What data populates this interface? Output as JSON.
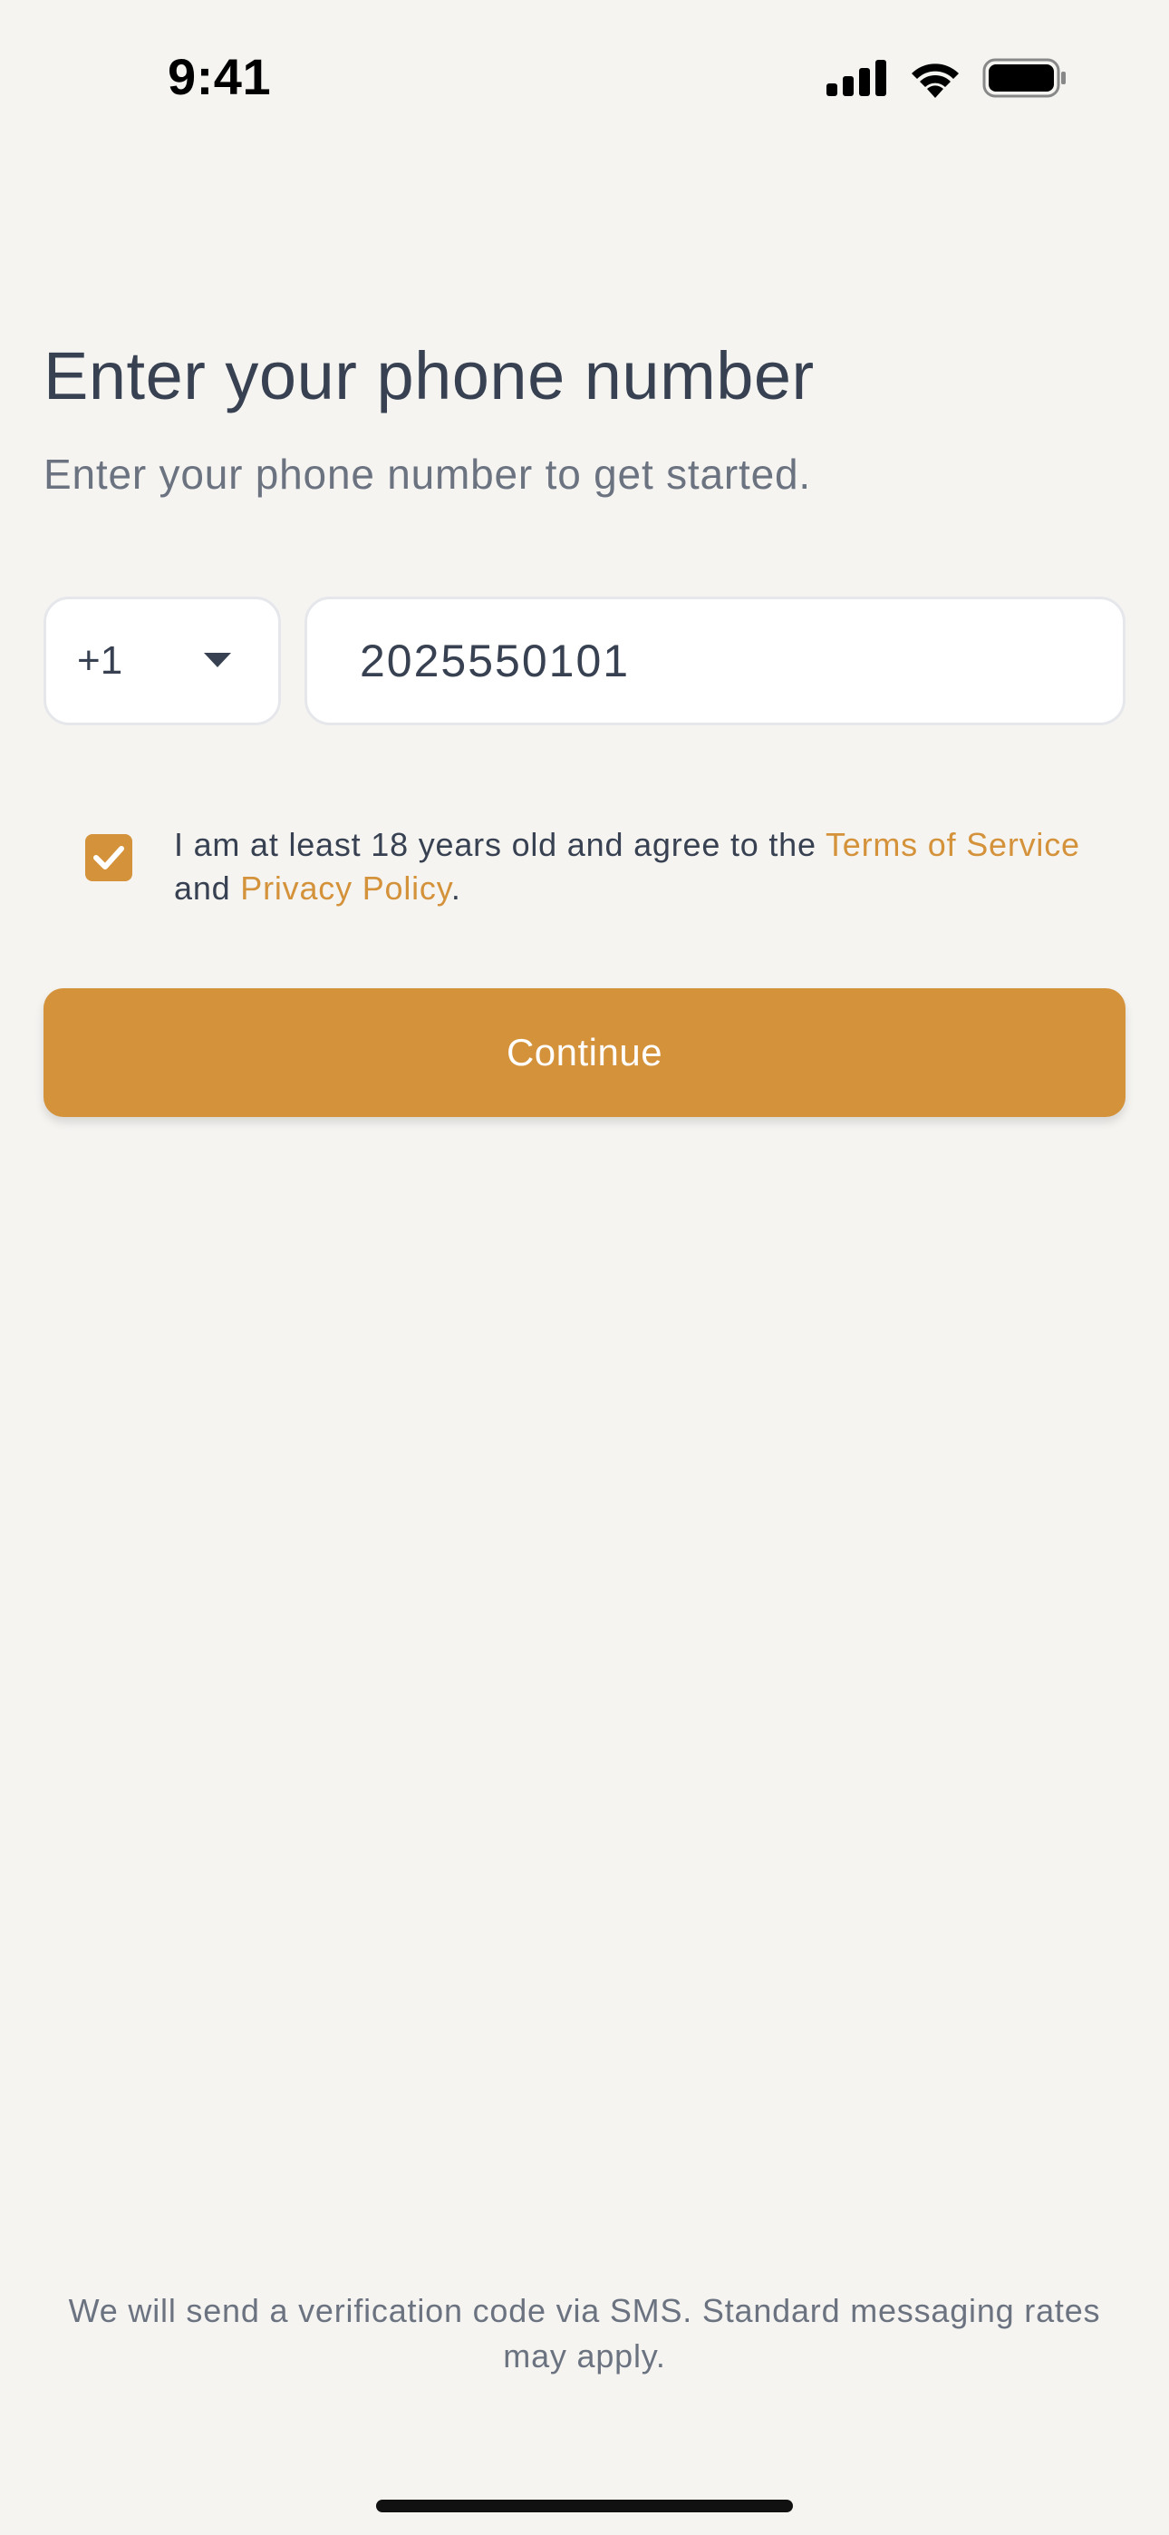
{
  "status_bar": {
    "time": "9:41"
  },
  "screen": {
    "title": "Enter your phone number",
    "subtitle": "Enter your phone number to get started."
  },
  "phone_form": {
    "country_code": "+1",
    "phone_value": "2025550101",
    "phone_placeholder": ""
  },
  "consent": {
    "checked": true,
    "text_before": "I am at least 18 years old and agree to the ",
    "terms_link": "Terms of Service",
    "text_middle": " and ",
    "privacy_link": "Privacy Policy",
    "text_after": "."
  },
  "actions": {
    "continue_label": "Continue"
  },
  "footer": {
    "note": "We will send a verification code via SMS. Standard messaging rates may apply."
  },
  "colors": {
    "accent": "#d4923a",
    "background": "#f5f4f1",
    "text_primary": "#374151",
    "text_secondary": "#6b7280"
  },
  "icons": {
    "signal": "cellular-signal-icon",
    "wifi": "wifi-icon",
    "battery": "battery-icon",
    "dropdown": "chevron-down-icon",
    "check": "checkmark-icon"
  }
}
